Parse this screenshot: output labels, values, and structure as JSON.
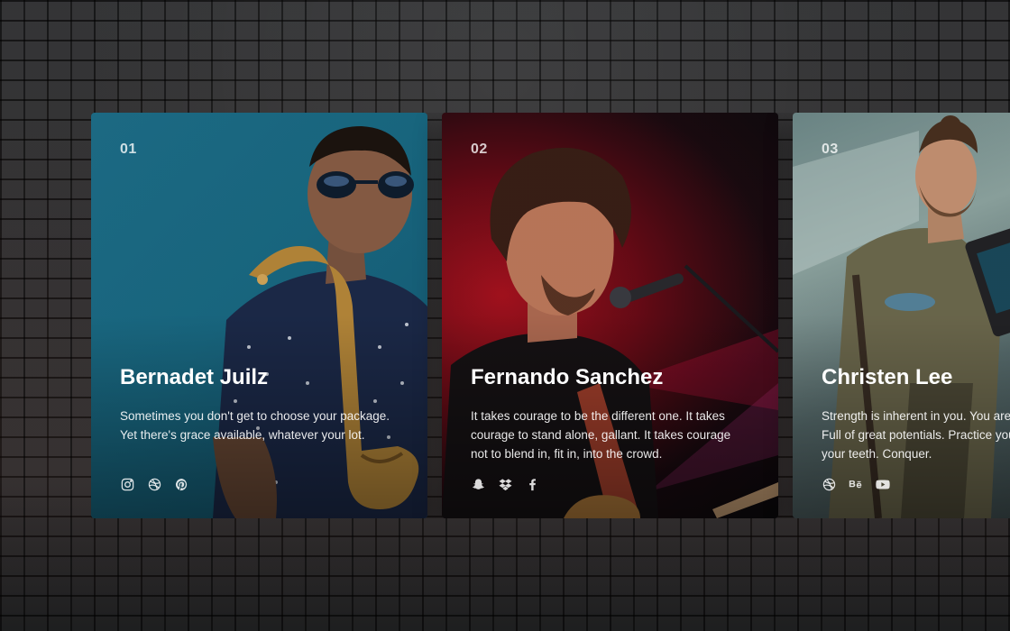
{
  "cards": [
    {
      "number": "01",
      "name": "Bernadet Juilz",
      "description": "Sometimes you don't get to choose your package. Yet there's grace available, whatever your lot.",
      "socials": [
        "instagram-icon",
        "dribbble-icon",
        "pinterest-icon"
      ]
    },
    {
      "number": "02",
      "name": "Fernando Sanchez",
      "description": "It takes courage to be the different one. It takes courage to stand alone, gallant. It takes courage not to blend in, fit in, into the crowd.",
      "socials": [
        "snapchat-icon",
        "dropbox-icon",
        "facebook-icon"
      ]
    },
    {
      "number": "03",
      "name": "Christen Lee",
      "description": "Strength is inherent in you. You are of the tribe. Full of great potentials. Practice your roar, sharpen your teeth. Conquer.",
      "socials": [
        "dribbble-icon",
        "behance-icon",
        "youtube-icon"
      ]
    }
  ],
  "colors": {
    "card1_bg": "#1d6f8a",
    "card2_bg": "#6a0b16",
    "card3_bg": "#6f8a8a",
    "wall": "#303133"
  }
}
